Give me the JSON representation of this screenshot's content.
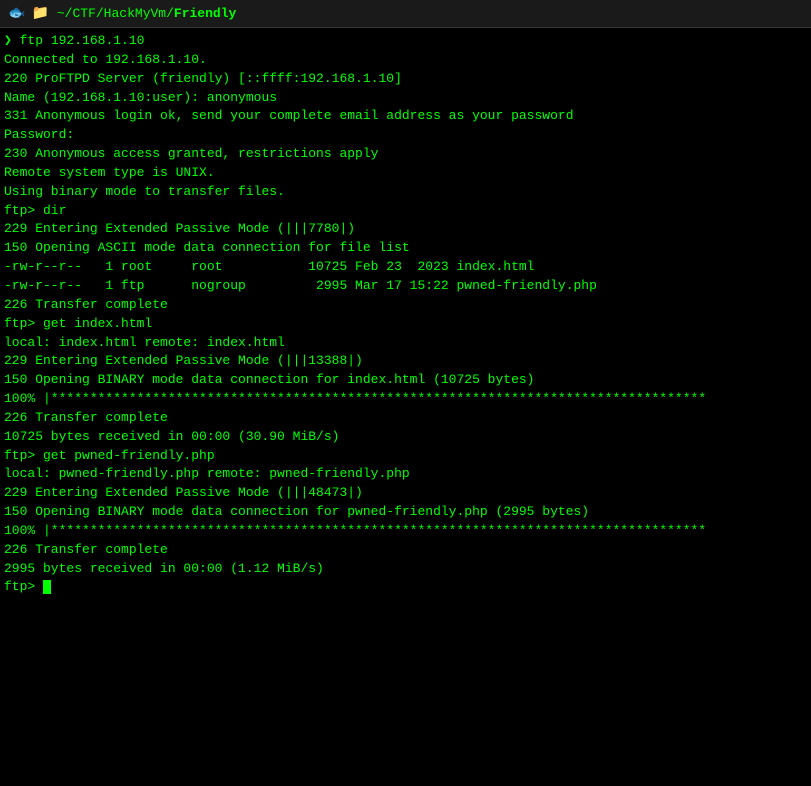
{
  "titleBar": {
    "icon1": "🐟",
    "icon2": "📁",
    "path": "~/CTF/HackMyVm/",
    "folderName": "Friendly"
  },
  "terminal": {
    "prompt": "❯",
    "lines": [
      {
        "type": "command",
        "text": "  ftp 192.168.1.10"
      },
      {
        "type": "output",
        "text": "Connected to 192.168.1.10."
      },
      {
        "type": "output",
        "text": "220 ProFTPD Server (friendly) [::ffff:192.168.1.10]"
      },
      {
        "type": "output",
        "text": "Name (192.168.1.10:user): anonymous"
      },
      {
        "type": "output",
        "text": "331 Anonymous login ok, send your complete email address as your password"
      },
      {
        "type": "output",
        "text": "Password:"
      },
      {
        "type": "output",
        "text": "230 Anonymous access granted, restrictions apply"
      },
      {
        "type": "output",
        "text": "Remote system type is UNIX."
      },
      {
        "type": "output",
        "text": "Using binary mode to transfer files."
      },
      {
        "type": "ftp-command",
        "text": "ftp> dir"
      },
      {
        "type": "output",
        "text": "229 Entering Extended Passive Mode (|||7780|)"
      },
      {
        "type": "output",
        "text": "150 Opening ASCII mode data connection for file list"
      },
      {
        "type": "output",
        "text": "-rw-r--r--   1 root     root           10725 Feb 23  2023 index.html"
      },
      {
        "type": "output",
        "text": "-rw-r--r--   1 ftp      nogroup         2995 Mar 17 15:22 pwned-friendly.php"
      },
      {
        "type": "output",
        "text": "226 Transfer complete"
      },
      {
        "type": "ftp-command",
        "text": "ftp> get index.html"
      },
      {
        "type": "output",
        "text": "local: index.html remote: index.html"
      },
      {
        "type": "output",
        "text": "229 Entering Extended Passive Mode (|||13388|)"
      },
      {
        "type": "output",
        "text": "150 Opening BINARY mode data connection for index.html (10725 bytes)"
      },
      {
        "type": "progress",
        "text": "100% |****************************************************************************"
      },
      {
        "type": "output",
        "text": "226 Transfer complete"
      },
      {
        "type": "output",
        "text": "10725 bytes received in 00:00 (30.90 MiB/s)"
      },
      {
        "type": "ftp-command",
        "text": "ftp> get pwned-friendly.php"
      },
      {
        "type": "output",
        "text": "local: pwned-friendly.php remote: pwned-friendly.php"
      },
      {
        "type": "output",
        "text": "229 Entering Extended Passive Mode (|||48473|)"
      },
      {
        "type": "output",
        "text": "150 Opening BINARY mode data connection for pwned-friendly.php (2995 bytes)"
      },
      {
        "type": "progress",
        "text": "100% |****************************************************************************"
      },
      {
        "type": "output",
        "text": "226 Transfer complete"
      },
      {
        "type": "output",
        "text": "2995 bytes received in 00:00 (1.12 MiB/s)"
      },
      {
        "type": "ftp-prompt",
        "text": "ftp> "
      }
    ]
  }
}
